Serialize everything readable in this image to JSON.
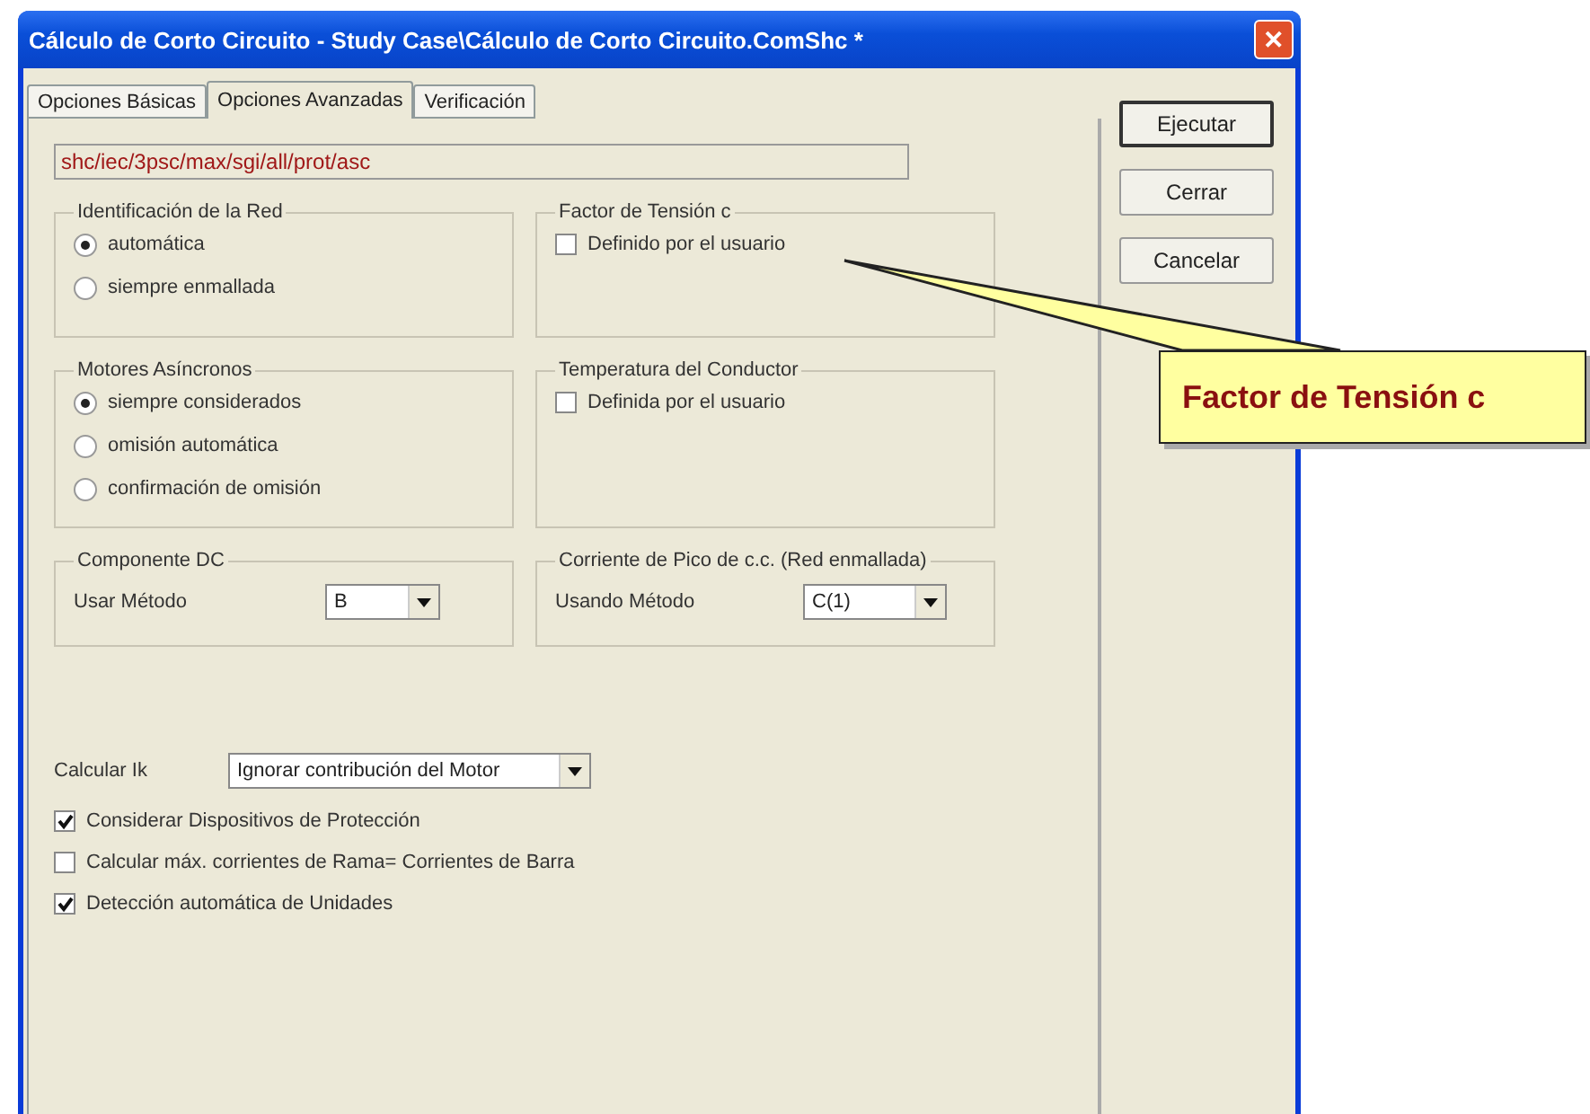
{
  "window": {
    "title": "Cálculo de Corto Circuito - Study Case\\Cálculo de Corto Circuito.ComShc *",
    "close": "✕"
  },
  "tabs": [
    {
      "label": "Opciones Básicas",
      "selected": false
    },
    {
      "label": "Opciones Avanzadas",
      "selected": true
    },
    {
      "label": "Verificación",
      "selected": false
    }
  ],
  "path_field": {
    "value": "shc/iec/3psc/max/sgi/all/prot/asc"
  },
  "groups": [
    {
      "title": "Identificación de la Red",
      "kind": "radio",
      "options": [
        {
          "label": "automática",
          "selected": true
        },
        {
          "label": "siempre enmallada",
          "selected": false
        }
      ]
    },
    {
      "title": "Factor de Tensión c",
      "kind": "checkbox",
      "options": [
        {
          "label": "Definido por el usuario",
          "checked": false
        }
      ]
    },
    {
      "title": "Motores Asíncronos",
      "kind": "radio",
      "options": [
        {
          "label": "siempre considerados",
          "selected": true
        },
        {
          "label": "omisión automática",
          "selected": false
        },
        {
          "label": "confirmación de omisión",
          "selected": false
        }
      ]
    },
    {
      "title": "Temperatura del Conductor",
      "kind": "checkbox",
      "options": [
        {
          "label": "Definida por el usuario",
          "checked": false
        }
      ]
    },
    {
      "title": "Componente DC",
      "kind": "select",
      "label": "Usar Método",
      "value": "B"
    },
    {
      "title": "Corriente de Pico de c.c. (Red enmallada)",
      "kind": "select",
      "label": "Usando Método",
      "value": "C(1)"
    }
  ],
  "calculate": {
    "label": "Calcular Ik",
    "value": "Ignorar contribución del Motor"
  },
  "options": [
    {
      "label": "Considerar Dispositivos de Protección",
      "checked": true
    },
    {
      "label": "Calcular máx. corrientes de Rama= Corrientes de Barra",
      "checked": false
    },
    {
      "label": "Detección automática de Unidades",
      "checked": true
    }
  ],
  "buttons": [
    {
      "label": "Ejecutar",
      "default": true
    },
    {
      "label": "Cerrar",
      "default": false
    },
    {
      "label": "Cancelar",
      "default": false
    }
  ],
  "callout": {
    "text": "Factor de Tensión c"
  }
}
